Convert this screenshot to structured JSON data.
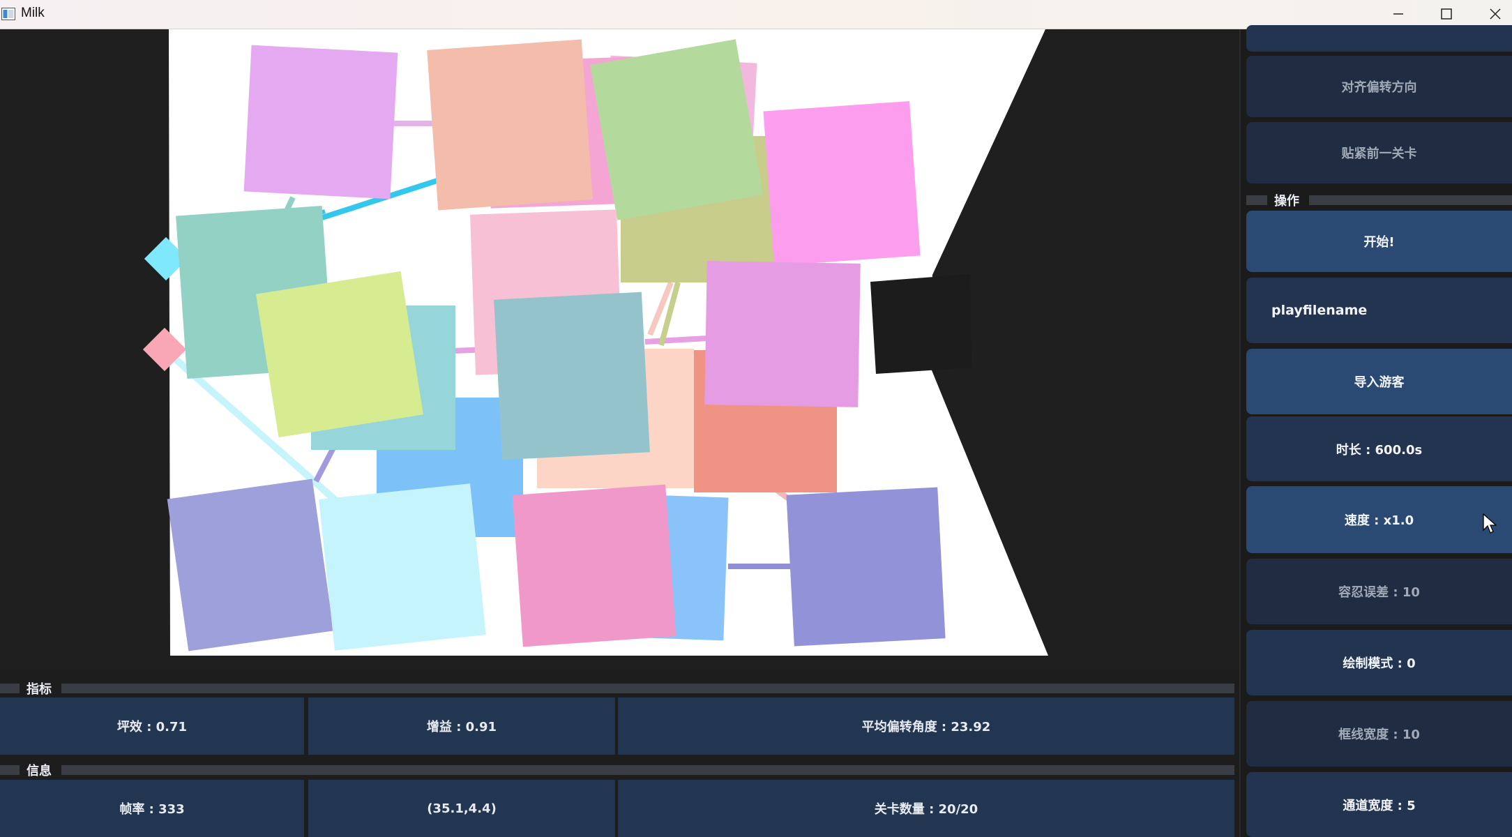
{
  "window": {
    "title": "Milk"
  },
  "metrics": {
    "header": "指标",
    "efficiency": "坪效 : 0.71",
    "gain": "增益 : 0.91",
    "avg_angle": "平均偏转角度 : 23.92"
  },
  "info": {
    "header": "信息",
    "fps": "帧率 : 333",
    "coords": "(35.1,4.4)",
    "level_count": "关卡数量 : 20/20"
  },
  "right_panel": {
    "align_direction": "对齐偏转方向",
    "snap_previous": "贴紧前一关卡",
    "operations_header": "操作",
    "start": "开始!",
    "playfilename": "playfilename",
    "import_tourist": "导入游客",
    "duration": "时长 : 600.0s",
    "speed": "速度 : x1.0",
    "tolerance": "容忍误差 : 10",
    "draw_mode": "绘制模式 : 0",
    "frame_width": "框线宽度 : 10",
    "channel_width": "通道宽度 : 5"
  },
  "colors": {
    "accent_button": "#2b4a73",
    "button": "#22344f",
    "button_dim": "#1f2c41",
    "cell": "#233651",
    "playfield": "#ffffff"
  }
}
